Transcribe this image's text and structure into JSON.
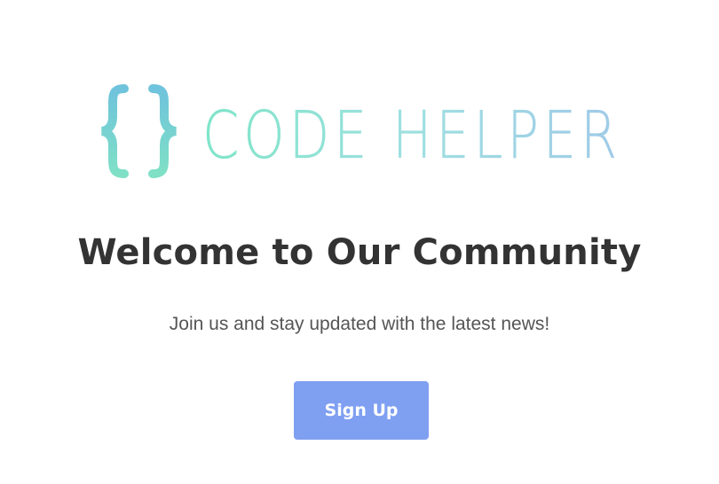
{
  "logo": {
    "brace_text": "{ }",
    "wordmark": "CODE HELPER",
    "colors": {
      "gradient_start": "#7fe5c9",
      "gradient_mid": "#9fdfe0",
      "gradient_end": "#9fcae8",
      "brace_left": "#74c9d9",
      "brace_right": "#7fd6d3"
    }
  },
  "hero": {
    "title": "Welcome to Our Community",
    "subtitle": "Join us and stay updated with the latest news!"
  },
  "cta": {
    "label": "Sign Up",
    "color": "#7f9ff1"
  }
}
